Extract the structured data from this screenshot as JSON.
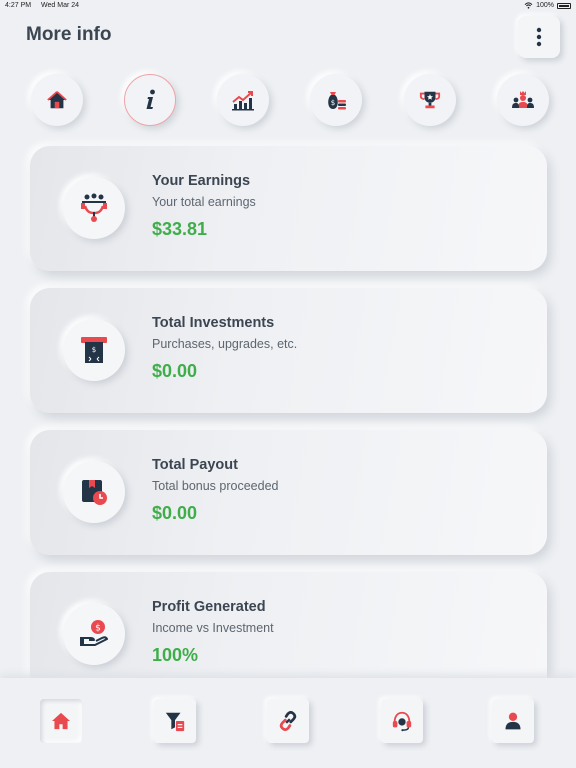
{
  "status": {
    "time": "4:27 PM",
    "date": "Wed Mar 24",
    "battery": "100%"
  },
  "header": {
    "title": "More info"
  },
  "top_nav": [
    {
      "icon": "home-icon"
    },
    {
      "icon": "info-icon",
      "active": true
    },
    {
      "icon": "chart-growth-icon"
    },
    {
      "icon": "money-bag-icon"
    },
    {
      "icon": "trophy-icon"
    },
    {
      "icon": "team-icon"
    }
  ],
  "cards": [
    {
      "title": "Your Earnings",
      "subtitle": "Your total earnings",
      "value": "$33.81",
      "icon": "network-person-icon"
    },
    {
      "title": "Total Investments",
      "subtitle": "Purchases, upgrades, etc.",
      "value": "$0.00",
      "icon": "atm-cash-icon"
    },
    {
      "title": "Total Payout",
      "subtitle": "Total bonus proceeded",
      "value": "$0.00",
      "icon": "box-clock-icon"
    },
    {
      "title": "Profit Generated",
      "subtitle": "Income vs Investment",
      "value": "100%",
      "icon": "hand-dollar-icon"
    }
  ],
  "bottom_tabs": [
    {
      "icon": "home-icon",
      "active": true
    },
    {
      "icon": "filter-doc-icon"
    },
    {
      "icon": "link-icon"
    },
    {
      "icon": "headset-icon"
    },
    {
      "icon": "user-icon"
    }
  ],
  "colors": {
    "accent_red": "#e84a4f",
    "navy": "#243447",
    "value_green": "#3fae4a",
    "background": "#eef0f3"
  }
}
